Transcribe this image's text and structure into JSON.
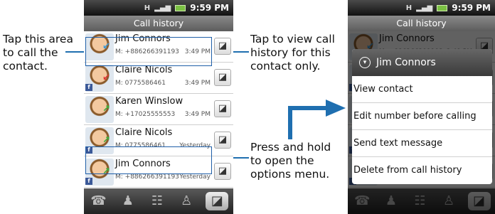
{
  "callouts": {
    "left": [
      "Tap this area",
      "to call the",
      "contact."
    ],
    "right_top": [
      "Tap to view call",
      "history for this",
      "contact only."
    ],
    "right_bottom": [
      "Press and hold",
      "to open the",
      "options menu."
    ]
  },
  "statusbar": {
    "time": "9:59 PM",
    "signal": "H"
  },
  "titlebar": {
    "title": "Call history"
  },
  "calls": [
    {
      "name": "Jim Connors",
      "number": "M: +886266391193",
      "time": "3:49 PM",
      "type": "incoming",
      "facebook": false
    },
    {
      "name": "Claire Nicols",
      "number": "M: 0775586461",
      "time": "3:49 PM",
      "type": "missed",
      "facebook": true
    },
    {
      "name": "Karen Winslow",
      "number": "M: +17025555553",
      "time": "3:49 PM",
      "type": "outgoing",
      "facebook": false
    },
    {
      "name": "Claire Nicols",
      "number": "M: 0775586461",
      "time": "Yesterday",
      "type": "outgoing",
      "facebook": true
    },
    {
      "name": "Jim Connors",
      "number": "M: +886266391193",
      "time": "Yesterday",
      "type": "outgoing",
      "facebook": true
    }
  ],
  "tabs": [
    "dialer-icon",
    "contacts-icon",
    "groups-icon",
    "favorites-icon",
    "call-history-icon"
  ],
  "menu": {
    "title": "Jim Connors",
    "items": [
      "View contact",
      "Edit number before calling",
      "Send text message",
      "Delete from call history"
    ]
  },
  "colors": {
    "callout_line": "#1f6fb0",
    "incoming": "#3a9ad9",
    "outgoing": "#3cae3c",
    "missed": "#d33333"
  }
}
